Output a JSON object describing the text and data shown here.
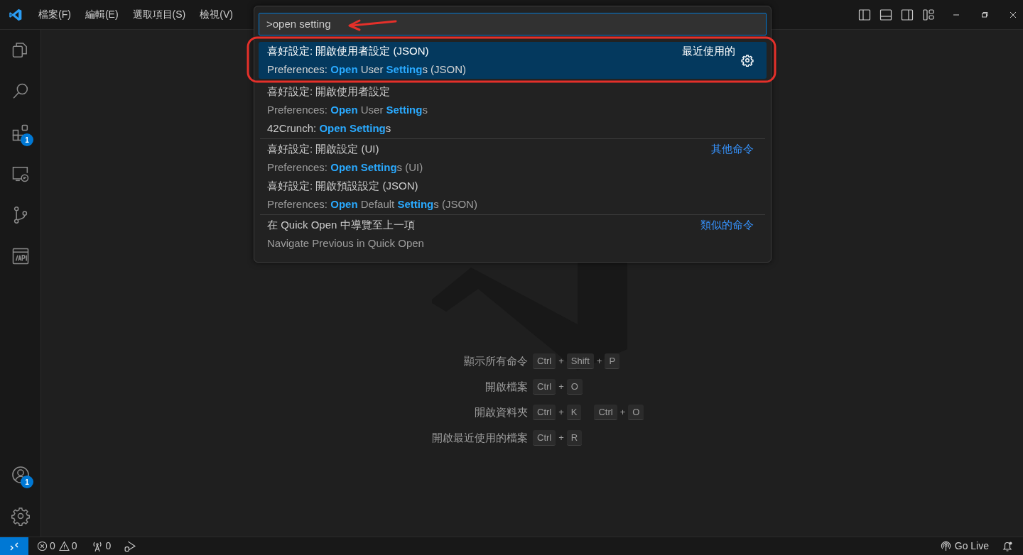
{
  "menu": [
    {
      "label": "檔案(F)"
    },
    {
      "label": "編輯(E)"
    },
    {
      "label": "選取項目(S)"
    },
    {
      "label": "檢視(V)"
    }
  ],
  "activity_bar": {
    "top": [
      {
        "kind": "explorer"
      },
      {
        "kind": "search"
      },
      {
        "kind": "extensions",
        "badge": "1"
      },
      {
        "kind": "remote"
      },
      {
        "kind": "scm"
      },
      {
        "kind": "api"
      }
    ],
    "bottom": [
      {
        "kind": "accounts",
        "badge": "1"
      },
      {
        "kind": "manage"
      }
    ]
  },
  "quick_open": {
    "value": ">open setting",
    "items": [
      {
        "label": "喜好設定: 開啟使用者設定 (JSON)",
        "detail": "Preferences: **Open** User **Setting**s (JSON)",
        "group_label": "最近使用的",
        "selected": true,
        "separator_above": false
      },
      {
        "label": "喜好設定: 開啟使用者設定",
        "detail": "Preferences: **Open** User **Setting**s",
        "selected": false,
        "separator_above": false
      },
      {
        "label": "42Crunch: **Open Setting**s",
        "selected": false,
        "separator_above": false
      },
      {
        "label": "喜好設定: 開啟設定 (UI)",
        "detail": "Preferences: **Open Setting**s (UI)",
        "group_label": "其他命令",
        "selected": false,
        "separator_above": true
      },
      {
        "label": "喜好設定: 開啟預設設定 (JSON)",
        "detail": "Preferences: **Open** Default **Setting**s (JSON)",
        "selected": false,
        "separator_above": false
      },
      {
        "label": "在 Quick Open 中導覽至上一項",
        "detail": "Navigate Previous in Quick Open",
        "group_label": "類似的命令",
        "selected": false,
        "separator_above": true
      }
    ]
  },
  "shortcuts": [
    {
      "label": "顯示所有命令",
      "chords": [
        [
          "Ctrl",
          "Shift",
          "P"
        ]
      ],
      "joiner": "+"
    },
    {
      "label": "開啟檔案",
      "chords": [
        [
          "Ctrl",
          "O"
        ]
      ],
      "joiner": "+"
    },
    {
      "label": "開啟資料夾",
      "chords": [
        [
          "Ctrl",
          "K"
        ],
        [
          "Ctrl",
          "O"
        ]
      ],
      "joiner": "+"
    },
    {
      "label": "開啟最近使用的檔案",
      "chords": [
        [
          "Ctrl",
          "R"
        ]
      ],
      "joiner": "+"
    }
  ],
  "status_bar": {
    "errors": "0",
    "warnings": "0",
    "ports": "0",
    "go_live": "Go Live"
  },
  "annotation_arrow": {
    "color": "#e5302a"
  },
  "annotation_outline": {
    "color": "#e5302a"
  }
}
